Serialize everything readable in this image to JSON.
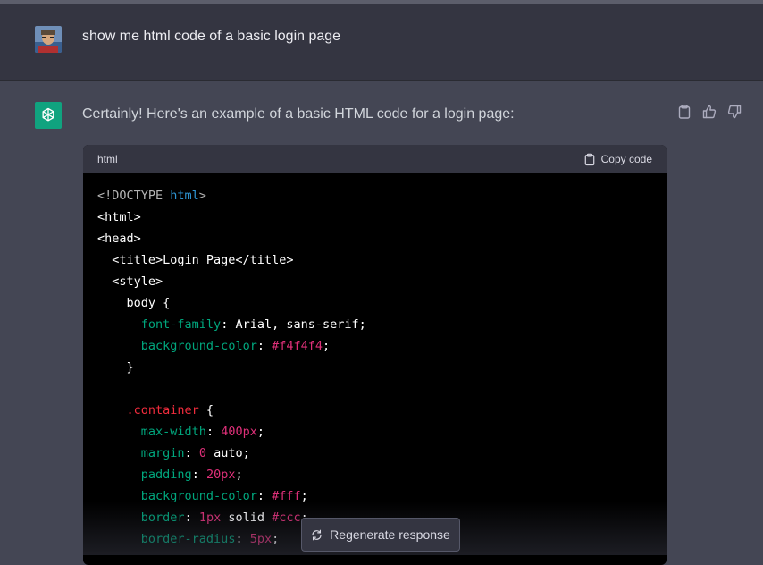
{
  "user_message": "show me html code of a basic login page",
  "assistant_message": "Certainly! Here's an example of a basic HTML code for a login page:",
  "code_block": {
    "language": "html",
    "copy_label": "Copy code"
  },
  "code_lines": [
    [
      {
        "t": "<!DOCTYPE ",
        "c": "c-gray"
      },
      {
        "t": "html",
        "c": "c-blue"
      },
      {
        "t": ">",
        "c": "c-gray"
      }
    ],
    [
      {
        "t": "<html>",
        "c": ""
      }
    ],
    [
      {
        "t": "<head>",
        "c": ""
      }
    ],
    [
      {
        "t": "  <title>Login Page</title>",
        "c": ""
      }
    ],
    [
      {
        "t": "  <style>",
        "c": ""
      }
    ],
    [
      {
        "t": "    body {",
        "c": ""
      }
    ],
    [
      {
        "t": "      ",
        "c": ""
      },
      {
        "t": "font-family",
        "c": "c-prop"
      },
      {
        "t": ": Arial, sans-serif;",
        "c": ""
      }
    ],
    [
      {
        "t": "      ",
        "c": ""
      },
      {
        "t": "background-color",
        "c": "c-prop"
      },
      {
        "t": ": ",
        "c": ""
      },
      {
        "t": "#f4f4f4",
        "c": "c-pink"
      },
      {
        "t": ";",
        "c": ""
      }
    ],
    [
      {
        "t": "    }",
        "c": ""
      }
    ],
    [
      {
        "t": "",
        "c": ""
      }
    ],
    [
      {
        "t": "    ",
        "c": ""
      },
      {
        "t": ".container",
        "c": "c-sel"
      },
      {
        "t": " {",
        "c": ""
      }
    ],
    [
      {
        "t": "      ",
        "c": ""
      },
      {
        "t": "max-width",
        "c": "c-prop"
      },
      {
        "t": ": ",
        "c": ""
      },
      {
        "t": "400px",
        "c": "c-pink"
      },
      {
        "t": ";",
        "c": ""
      }
    ],
    [
      {
        "t": "      ",
        "c": ""
      },
      {
        "t": "margin",
        "c": "c-prop"
      },
      {
        "t": ": ",
        "c": ""
      },
      {
        "t": "0",
        "c": "c-pink"
      },
      {
        "t": " auto;",
        "c": ""
      }
    ],
    [
      {
        "t": "      ",
        "c": ""
      },
      {
        "t": "padding",
        "c": "c-prop"
      },
      {
        "t": ": ",
        "c": ""
      },
      {
        "t": "20px",
        "c": "c-pink"
      },
      {
        "t": ";",
        "c": ""
      }
    ],
    [
      {
        "t": "      ",
        "c": ""
      },
      {
        "t": "background-color",
        "c": "c-prop"
      },
      {
        "t": ": ",
        "c": ""
      },
      {
        "t": "#fff",
        "c": "c-pink"
      },
      {
        "t": ";",
        "c": ""
      }
    ],
    [
      {
        "t": "      ",
        "c": ""
      },
      {
        "t": "border",
        "c": "c-prop"
      },
      {
        "t": ": ",
        "c": ""
      },
      {
        "t": "1px",
        "c": "c-pink"
      },
      {
        "t": " solid ",
        "c": ""
      },
      {
        "t": "#ccc",
        "c": "c-pink"
      },
      {
        "t": ";",
        "c": ""
      }
    ],
    [
      {
        "t": "      ",
        "c": ""
      },
      {
        "t": "border-radius",
        "c": "c-prop"
      },
      {
        "t": ": ",
        "c": ""
      },
      {
        "t": "5px",
        "c": "c-pink"
      },
      {
        "t": ";",
        "c": ""
      }
    ]
  ],
  "regenerate_label": "Regenerate response",
  "colors": {
    "accent": "#10a37f",
    "user_bg": "#343541",
    "assistant_bg": "#444654",
    "code_bg": "#000000"
  },
  "icons": {
    "clipboard": "clipboard-icon",
    "thumbs_up": "thumbs-up-icon",
    "thumbs_down": "thumbs-down-icon",
    "regenerate": "refresh-icon"
  }
}
